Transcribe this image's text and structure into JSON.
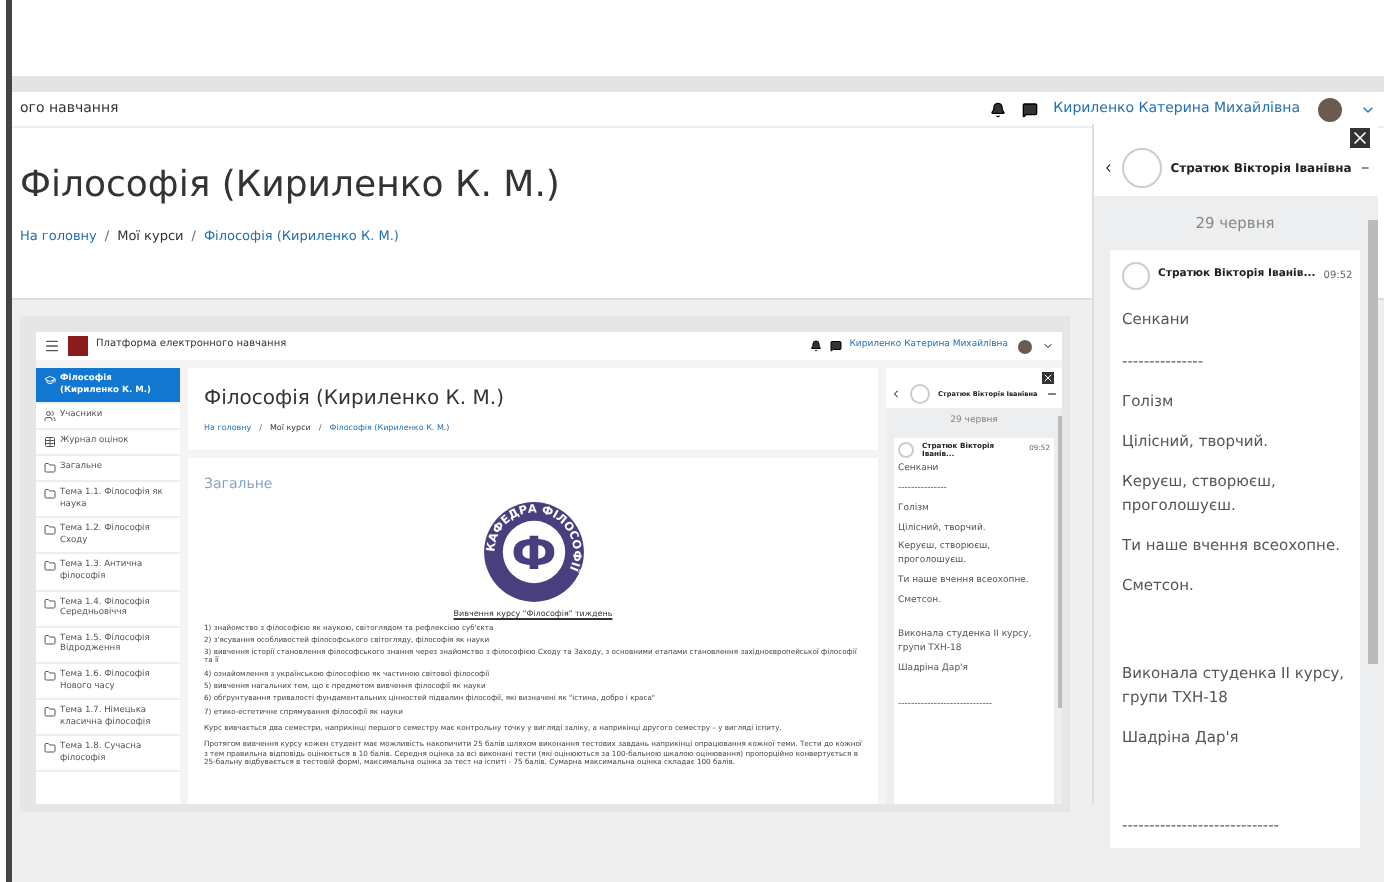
{
  "top_bar": {
    "site_title": "ого навчання",
    "user_name": "Кириленко Катерина Михайлівна"
  },
  "page": {
    "title": "Філософія (Кириленко К. М.)",
    "separator": "/",
    "breadcrumb": [
      {
        "label": "На головну",
        "link": true
      },
      {
        "label": "Мої курси",
        "link": false
      },
      {
        "label": "Філософія (Кириленко К. М.)",
        "link": true
      }
    ]
  },
  "chat": {
    "contact": "Стратюк Вікторія Іванівна",
    "date": "29 червня",
    "sender": "Стратюк Вікторія Іванів...",
    "time": "09:52",
    "blocks": [
      [
        "Сенкани",
        "---------------",
        "Голізм",
        "Цілісний, творчий.",
        "Керуєш, створюєш, проголошуєш.",
        "Ти наше вчення всеохопне.",
        "Сметсон."
      ],
      [
        "Виконала студенка II курсу, групи ТХН-18",
        "Шадріна Дар'я"
      ],
      [
        "-----------------------------"
      ]
    ]
  },
  "embedded": {
    "site_title": "Платформа електронного навчання",
    "user_name": "Кириленко Катерина Михайлівна",
    "sidebar": [
      {
        "label": "Філософія (Кириленко К. М.)",
        "kind": "course",
        "selected": true
      },
      {
        "label": "Учасники",
        "kind": "participants",
        "selected": false
      },
      {
        "label": "Журнал оцінок",
        "kind": "grades",
        "selected": false
      },
      {
        "label": "Загальне",
        "kind": "section",
        "selected": false
      },
      {
        "label": "Тема 1.1. Філософія як наука",
        "kind": "section",
        "selected": false
      },
      {
        "label": "Тема 1.2. Філософія Сходу",
        "kind": "section",
        "selected": false
      },
      {
        "label": "Тема 1.3. Антична філософія",
        "kind": "section",
        "selected": false
      },
      {
        "label": "Тема 1.4. Філософія Середньовіччя",
        "kind": "section",
        "selected": false
      },
      {
        "label": "Тема 1.5. Філософія Відродження",
        "kind": "section",
        "selected": false
      },
      {
        "label": "Тема 1.6. Філософія Нового часу",
        "kind": "section",
        "selected": false
      },
      {
        "label": "Тема 1.7. Німецька класична філософія",
        "kind": "section",
        "selected": false
      },
      {
        "label": "Тема 1.8. Сучасна філософія",
        "kind": "section",
        "selected": false
      }
    ],
    "title": "Філософія (Кириленко К. М.)",
    "separator": "/",
    "breadcrumb": [
      {
        "label": "На головну",
        "link": true
      },
      {
        "label": "Мої курси",
        "link": false
      },
      {
        "label": "Філософія (Кириленко К. М.)",
        "link": true
      }
    ],
    "section_title": "Загальне",
    "logo": {
      "ring_text": "КАФЕДРА ФІЛОСОФІЇ",
      "letter": "Ф"
    },
    "logo_link": "Вивчення курсу \"Філософія\" тиждень",
    "objectives": [
      "1) знайомство з філософією як наукою, світоглядом та рефлексією суб'єкта",
      "2) з'ясування особливостей філософського світогляду, філософія як науки",
      "3) вивчення історії становлення філософського знання через знайомство з філософією Сходу та Заходу, з основними етапами становлення західноєвропейської філософії та її",
      "4) ознайомлення з українською філософією як частиною світової філософії",
      "5) вивчення нагальних тем, що є предметом вивчення філософії як науки",
      "6) обґрунтування тривалості фундаментальних цінностей підвалин філософії, які визначені як \"істина, добро і краса\"",
      "7) етико-естетичне спрямування філософії як науки"
    ],
    "paragraphs": [
      "Курс вивчається два семестри, наприкінці першого семестру має контрольну точку у вигляді заліку, а наприкінці другого семестру – у вигляді іспиту.",
      "Протягом вивчення курсу кожен студент має можливість накопичити 25 балів шляхом виконання тестових завдань наприкінці опрацювання кожної теми. Тести до кожної з тем правильна відповідь оцінюється в 10 балів. Середня оцінка за всі виконані тести (які оцінюються за 100-бальною шкалою оцінювання) пропорційно конвертується в 25-бальну відбувається в тестовій формі, максимальна оцінка за тест на іспиті - 75 балів. Сумарна максимальна оцінка складає 100 балів."
    ],
    "chat": {
      "contact": "Стратюк Вікторія Іванівна",
      "date": "29 червня",
      "sender": "Стратюк Вікторія Іванів...",
      "time": "09:52",
      "blocks": [
        [
          "Сенкани",
          "---------------",
          "Голізм",
          "Цілісний, творчий.",
          "Керуєш, створюєш, проголошуєш.",
          "Ти наше вчення всеохопне.",
          "Сметсон."
        ],
        [
          "Виконала студенка II курсу, групи ТХН-18",
          "Шадріна Дар'я"
        ],
        [
          "-----------------------------"
        ]
      ]
    }
  }
}
